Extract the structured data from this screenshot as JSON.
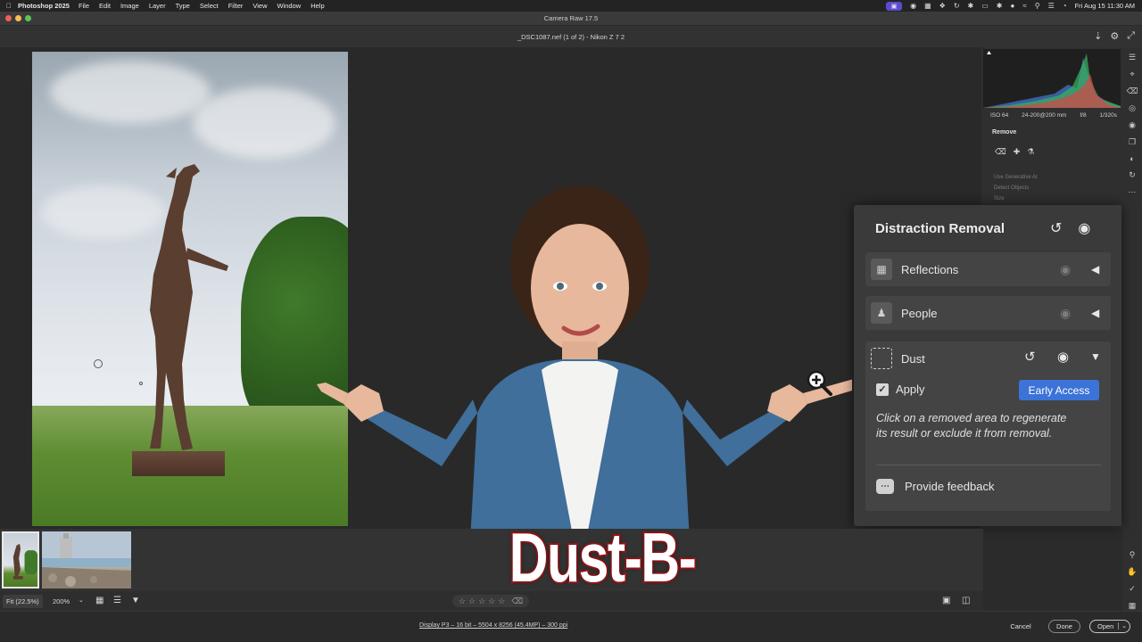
{
  "menubar": {
    "app_name": "Photoshop 2025",
    "items": [
      "File",
      "Edit",
      "Image",
      "Layer",
      "Type",
      "Select",
      "Filter",
      "View",
      "Window",
      "Help"
    ],
    "datetime": "Fri Aug 15  11:30 AM"
  },
  "window": {
    "title": "Camera Raw 17.5",
    "file_info": "_DSC1087.nef (1 of 2)  -  Nikon Z 7 2"
  },
  "histogram": {
    "iso": "ISO 64",
    "lens": "24-200@200 mm",
    "aperture": "f/8",
    "shutter": "1/320s"
  },
  "remove_panel": {
    "title": "Remove",
    "use_generative_ai": "Use Generative AI",
    "detect_objects": "Detect Objects",
    "size": "Size"
  },
  "distraction_removal": {
    "title": "Distraction Removal",
    "reflections_label": "Reflections",
    "people_label": "People",
    "dust_label": "Dust",
    "apply_label": "Apply",
    "apply_checked": true,
    "early_access_label": "Early Access",
    "help_text": "Click on a removed area to regenerate its result or exclude it from removal.",
    "feedback_label": "Provide feedback"
  },
  "headline": "Dust-B-Gone",
  "toolbar": {
    "fit_label": "Fit (22.5%)",
    "zoom_label": "200%",
    "rating_stars": 5
  },
  "status": {
    "display_info": "Display P3 – 16 bit – 5504 x 8256 (45.4MP) – 300 ppi",
    "cancel_label": "Cancel",
    "done_label": "Done",
    "open_label": "Open"
  },
  "colors": {
    "accent_blue": "#3b73d8",
    "headline_stroke": "#b3161b",
    "panel_bg": "#3a3a3a"
  }
}
